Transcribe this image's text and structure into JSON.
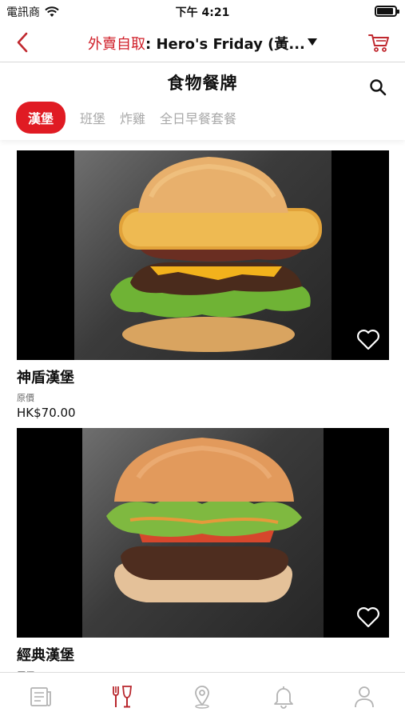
{
  "status_bar": {
    "carrier": "電訊商",
    "time": "下午 4:21"
  },
  "nav": {
    "mode": "外賣自取",
    "colon": ":",
    "store": " Hero's Friday (黃..."
  },
  "menu": {
    "heading": "食物餐牌",
    "tabs": [
      {
        "label": "漢堡",
        "active": true
      },
      {
        "label": "班堡",
        "active": false
      },
      {
        "label": "炸雞",
        "active": false
      },
      {
        "label": "全日早餐套餐",
        "active": false
      }
    ]
  },
  "items": [
    {
      "name": "神盾漢堡",
      "price_label": "原價",
      "price": "HK$70.00"
    },
    {
      "name": "經典漢堡",
      "price_label": "原價",
      "price": ""
    }
  ],
  "bottom_tabs": [
    {
      "icon": "news-icon",
      "active": false
    },
    {
      "icon": "menu-fork-glass-icon",
      "active": true
    },
    {
      "icon": "location-pin-icon",
      "active": false
    },
    {
      "icon": "bell-icon",
      "active": false
    },
    {
      "icon": "profile-icon",
      "active": false
    }
  ],
  "colors": {
    "accent": "#d0202a",
    "tab_active_bg": "#e01b23",
    "inactive": "#a9a9a9"
  }
}
